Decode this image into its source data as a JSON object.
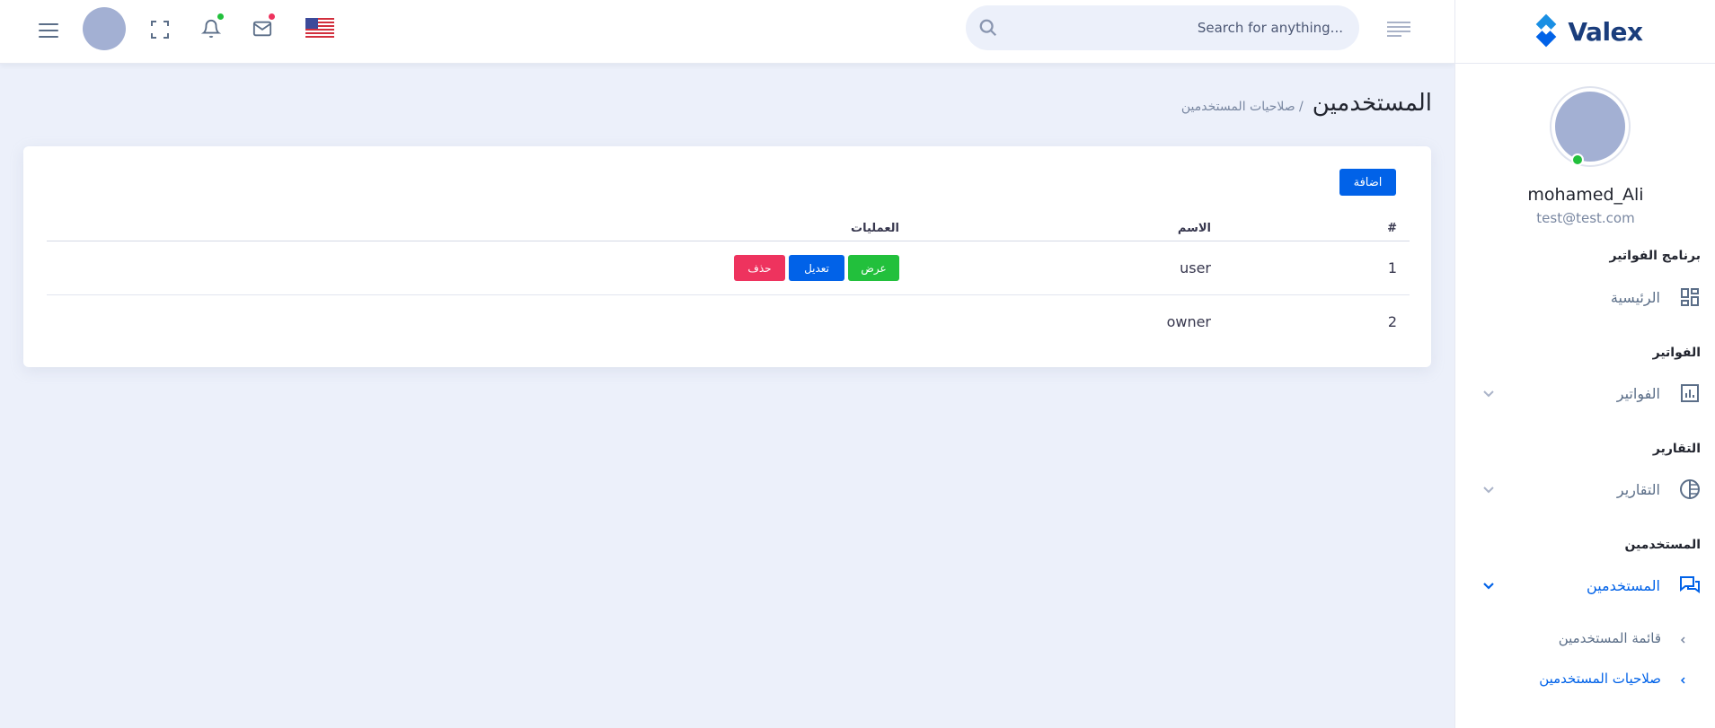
{
  "header": {
    "search_placeholder": "Search for anything...",
    "icons": [
      "menu-icon",
      "fullscreen-icon",
      "bell-icon",
      "mail-icon",
      "us-flag-icon",
      "search-icon",
      "lines-icon"
    ]
  },
  "sidebar": {
    "brand": "Valex",
    "user_name": "mohamed_Ali",
    "user_email": "test@test.com",
    "categories": [
      {
        "title": "برنامج الفواتير",
        "items": [
          {
            "label": "الرئيسية",
            "icon": "dashboard-icon"
          }
        ]
      },
      {
        "title": "الفواتير",
        "items": [
          {
            "label": "الفواتير",
            "icon": "chart-icon"
          }
        ]
      },
      {
        "title": "التقارير",
        "items": [
          {
            "label": "التقارير",
            "icon": "pie-icon"
          }
        ]
      },
      {
        "title": "المستخدمين",
        "items": [
          {
            "label": "المستخدمين",
            "icon": "chat-icon"
          }
        ]
      }
    ],
    "sub_items": [
      "قائمة المستخدمين",
      "صلاحيات المستخدمين"
    ]
  },
  "page": {
    "title": "المستخدمين",
    "subtitle": "/ صلاحيات المستخدمين"
  },
  "card": {
    "add_label": "اضافة",
    "columns": [
      "#",
      "الاسم",
      "العمليات"
    ],
    "rows": [
      {
        "num": "1",
        "name": "user",
        "actions": [
          "عرض",
          "تعديل",
          "حذف"
        ]
      },
      {
        "num": "2",
        "name": "owner",
        "actions": []
      }
    ]
  },
  "colors": {
    "primary": "#0162e8",
    "success": "#22c03c",
    "danger": "#ee335e",
    "background": "#ecf0fa"
  }
}
